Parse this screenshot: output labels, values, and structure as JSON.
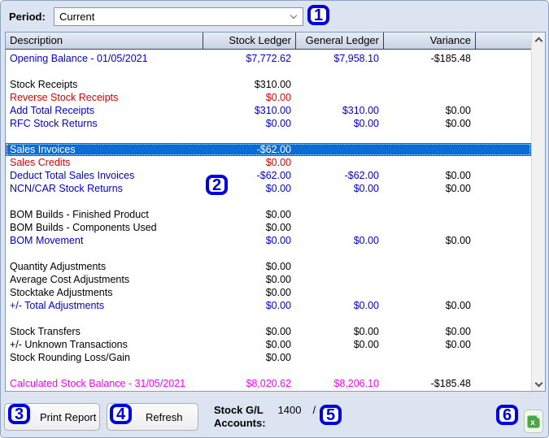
{
  "period": {
    "label": "Period:",
    "value": "Current"
  },
  "table": {
    "columns": [
      "Description",
      "Stock Ledger",
      "General Ledger",
      "Variance"
    ],
    "rows": [
      {
        "desc": "Opening Balance - 01/05/2021",
        "stock": "$7,772.62",
        "general": "$7,958.10",
        "variance": "-$185.48",
        "style": "blue"
      },
      {
        "blank": true
      },
      {
        "desc": "Stock Receipts",
        "stock": "$310.00",
        "general": "",
        "variance": "",
        "style": "black"
      },
      {
        "desc": "Reverse Stock Receipts",
        "stock": "$0.00",
        "general": "",
        "variance": "",
        "style": "red"
      },
      {
        "desc": "Add Total Receipts",
        "stock": "$310.00",
        "general": "$310.00",
        "variance": "$0.00",
        "style": "blue"
      },
      {
        "desc": "RFC Stock Returns",
        "stock": "$0.00",
        "general": "$0.00",
        "variance": "$0.00",
        "style": "blue"
      },
      {
        "blank": true
      },
      {
        "desc": "Sales Invoices",
        "stock": "-$62.00",
        "general": "",
        "variance": "",
        "style": "selected"
      },
      {
        "desc": "Sales Credits",
        "stock": "$0.00",
        "general": "",
        "variance": "",
        "style": "red"
      },
      {
        "desc": "Deduct Total Sales Invoices",
        "stock": "-$62.00",
        "general": "-$62.00",
        "variance": "$0.00",
        "style": "blue"
      },
      {
        "desc": "NCN/CAR Stock Returns",
        "stock": "$0.00",
        "general": "$0.00",
        "variance": "$0.00",
        "style": "blue"
      },
      {
        "blank": true
      },
      {
        "desc": "BOM Builds - Finished Product",
        "stock": "$0.00",
        "general": "",
        "variance": "",
        "style": "black"
      },
      {
        "desc": "BOM Builds - Components Used",
        "stock": "$0.00",
        "general": "",
        "variance": "",
        "style": "black"
      },
      {
        "desc": "BOM Movement",
        "stock": "$0.00",
        "general": "$0.00",
        "variance": "$0.00",
        "style": "blue"
      },
      {
        "blank": true
      },
      {
        "desc": "Quantity Adjustments",
        "stock": "$0.00",
        "general": "",
        "variance": "",
        "style": "black"
      },
      {
        "desc": "Average Cost Adjustments",
        "stock": "$0.00",
        "general": "",
        "variance": "",
        "style": "black"
      },
      {
        "desc": "Stocktake Adjustments",
        "stock": "$0.00",
        "general": "",
        "variance": "",
        "style": "black"
      },
      {
        "desc": "+/- Total Adjustments",
        "stock": "$0.00",
        "general": "$0.00",
        "variance": "$0.00",
        "style": "blue"
      },
      {
        "blank": true
      },
      {
        "desc": "Stock Transfers",
        "stock": "$0.00",
        "general": "$0.00",
        "variance": "$0.00",
        "style": "black"
      },
      {
        "desc": "+/- Unknown Transactions",
        "stock": "$0.00",
        "general": "$0.00",
        "variance": "$0.00",
        "style": "black"
      },
      {
        "desc": "Stock Rounding Loss/Gain",
        "stock": "$0.00",
        "general": "",
        "variance": "",
        "style": "black"
      },
      {
        "blank": true
      },
      {
        "desc": "Calculated Stock Balance - 31/05/2021",
        "stock": "$8,020.62",
        "general": "$8,206.10",
        "variance": "-$185.48",
        "style": "magenta"
      }
    ]
  },
  "footer": {
    "print_label": "Print Report",
    "refresh_label": "Refresh",
    "accounts_label_line1": "Stock G/L",
    "accounts_label_line2": "Accounts:",
    "accounts_value": "1400",
    "accounts_separator": "/"
  },
  "icons": {
    "period_dropdown": "chevron-down-icon",
    "scroll_up": "chevron-up-icon",
    "scroll_down": "chevron-down-icon",
    "export": "excel-export-icon"
  },
  "marks": [
    "1",
    "2",
    "3",
    "4",
    "5",
    "6"
  ],
  "colors": {
    "window_background": "#dbe4f0",
    "selection_blue": "#0d6bd7",
    "text_blue": "#0000dd",
    "text_red": "#e00000",
    "text_magenta": "#ff00ff",
    "annotation_blue": "#0000e0",
    "excel_green": "#4ba647"
  }
}
